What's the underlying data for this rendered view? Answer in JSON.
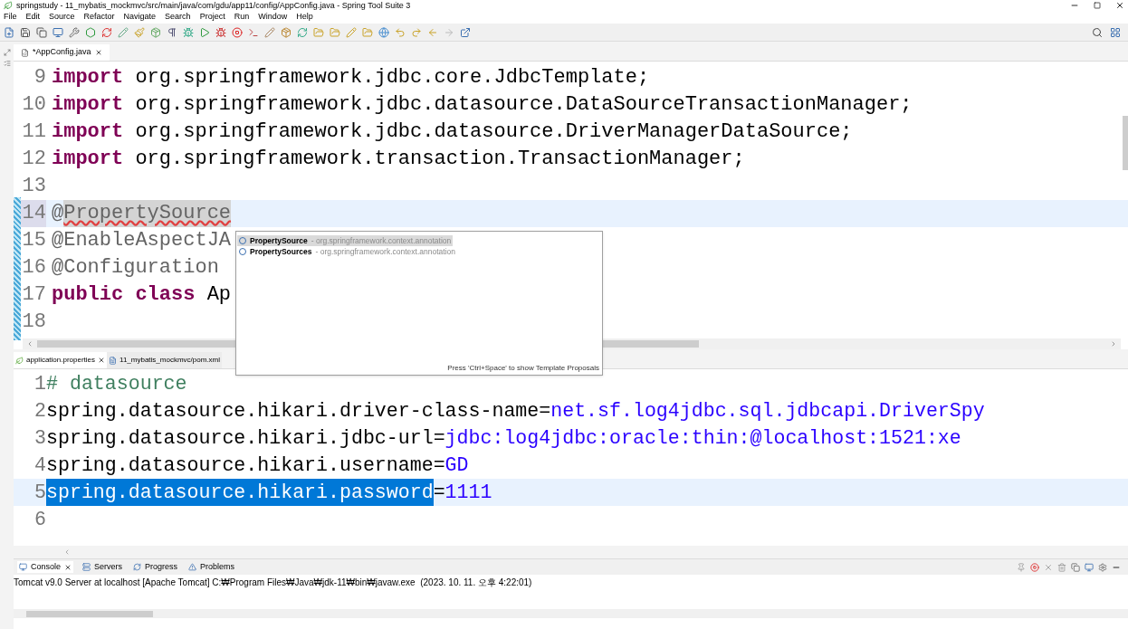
{
  "window": {
    "title": "springstudy - 11_mybatis_mockmvc/src/main/java/com/gdu/app11/config/AppConfig.java - Spring Tool Suite 3"
  },
  "menu": [
    "File",
    "Edit",
    "Source",
    "Refactor",
    "Navigate",
    "Search",
    "Project",
    "Run",
    "Window",
    "Help"
  ],
  "editor": {
    "tabs": [
      {
        "label": "*AppConfig.java",
        "selected": true
      }
    ],
    "lines": [
      {
        "number": "9",
        "current": false,
        "tokens": [
          {
            "kind": "keyword",
            "text": "import"
          },
          {
            "kind": "plain",
            "text": " org.springframework.jdbc.core.JdbcTemplate;"
          }
        ]
      },
      {
        "number": "10",
        "current": false,
        "tokens": [
          {
            "kind": "keyword",
            "text": "import"
          },
          {
            "kind": "plain",
            "text": " org.springframework.jdbc.datasource.DataSourceTransactionManager;"
          }
        ]
      },
      {
        "number": "11",
        "current": false,
        "tokens": [
          {
            "kind": "keyword",
            "text": "import"
          },
          {
            "kind": "plain",
            "text": " org.springframework.jdbc.datasource.DriverManagerDataSource;"
          }
        ]
      },
      {
        "number": "12",
        "current": false,
        "tokens": [
          {
            "kind": "keyword",
            "text": "import"
          },
          {
            "kind": "plain",
            "text": " org.springframework.transaction.TransactionManager;"
          }
        ]
      },
      {
        "number": "13",
        "current": false
      },
      {
        "number": "14",
        "current": true,
        "tokens": [
          {
            "kind": "annotation",
            "text": "@"
          },
          {
            "kind": "error",
            "text": "PropertySource"
          }
        ]
      },
      {
        "number": "15",
        "current": false,
        "tokens": [
          {
            "kind": "annotation",
            "text": "@EnableAspectJA"
          }
        ]
      },
      {
        "number": "16",
        "current": false,
        "tokens": [
          {
            "kind": "annotation",
            "text": "@Configuration"
          }
        ]
      },
      {
        "number": "17",
        "current": false,
        "tokens": [
          {
            "kind": "keyword",
            "text": "public class"
          },
          {
            "kind": "plain",
            "text": " Ap"
          }
        ]
      },
      {
        "number": "18",
        "current": false
      }
    ]
  },
  "proposals": {
    "items": [
      {
        "name": "PropertySource",
        "package": "- org.springframework.context.annotation",
        "selected": true
      },
      {
        "name": "PropertySources",
        "package": "- org.springframework.context.annotation",
        "selected": false
      }
    ],
    "hint": "Press 'Ctrl+Space' to show Template Proposals"
  },
  "properties_editor": {
    "tabs": [
      {
        "label": "application.properties",
        "selected": true
      },
      {
        "label": "11_mybatis_mockmvc/pom.xml",
        "selected": false
      }
    ],
    "lines": [
      {
        "number": "1",
        "tokens": [
          {
            "kind": "comment",
            "text": "# datasource"
          }
        ]
      },
      {
        "number": "2",
        "tokens": [
          {
            "kind": "key",
            "text": "spring.datasource.hikari.driver-class-name"
          },
          {
            "kind": "key",
            "text": "="
          },
          {
            "kind": "value",
            "text": "net.sf.log4jdbc.sql.jdbcapi.DriverSpy"
          }
        ]
      },
      {
        "number": "3",
        "tokens": [
          {
            "kind": "key",
            "text": "spring.datasource.hikari.jdbc-url"
          },
          {
            "kind": "key",
            "text": "="
          },
          {
            "kind": "value",
            "text": "jdbc:log4jdbc:oracle:thin:@localhost:1521:xe"
          }
        ]
      },
      {
        "number": "4",
        "tokens": [
          {
            "kind": "key",
            "text": "spring.datasource.hikari.username"
          },
          {
            "kind": "key",
            "text": "="
          },
          {
            "kind": "value",
            "text": "GD"
          }
        ]
      },
      {
        "number": "5",
        "tokens": [
          {
            "kind": "selected",
            "text": "spring.datasource.hikari.password"
          },
          {
            "kind": "key",
            "text": "="
          },
          {
            "kind": "value",
            "text": "1111"
          }
        ]
      },
      {
        "number": "6"
      }
    ]
  },
  "console": {
    "tabs": [
      {
        "label": "Console",
        "selected": true
      },
      {
        "label": "Servers",
        "selected": false
      },
      {
        "label": "Progress",
        "selected": false
      },
      {
        "label": "Problems",
        "selected": false
      }
    ],
    "text": "Tomcat v9.0 Server at localhost [Apache Tomcat] C:₩Program Files₩Java₩jdk-11₩bin₩javaw.exe  (2023. 10. 11. 오후 4:22:01)"
  }
}
